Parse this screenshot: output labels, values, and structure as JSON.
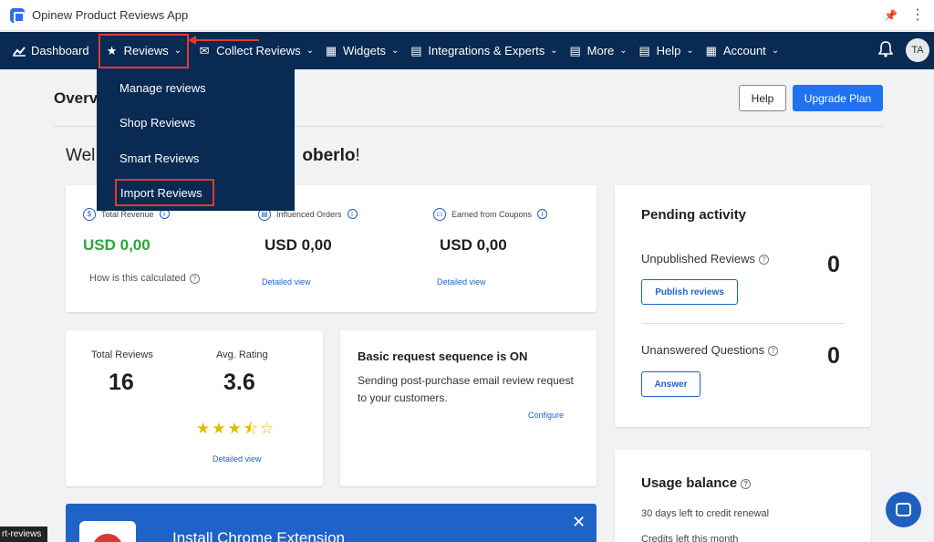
{
  "window": {
    "title": "Opinew Product Reviews App"
  },
  "nav": {
    "dashboard": "Dashboard",
    "reviews": "Reviews",
    "collect_reviews": "Collect Reviews",
    "widgets": "Widgets",
    "integrations": "Integrations & Experts",
    "more": "More",
    "help": "Help",
    "account": "Account",
    "avatar": "TA"
  },
  "dropdown": {
    "items": [
      "Manage reviews",
      "Shop Reviews",
      "Smart Reviews",
      "Import Reviews"
    ]
  },
  "header": {
    "title": "Overv",
    "help_button": "Help",
    "upgrade_button": "Upgrade Plan"
  },
  "welcome": {
    "prefix": "Wel",
    "suffix": "oberlo",
    "end": "!"
  },
  "revenue_card": {
    "total_revenue_label": "Total Revenue",
    "total_revenue_value": "USD 0,00",
    "how_calculated": "How is this calculated",
    "influenced_orders_label": "Influenced Orders",
    "influenced_orders_value": "USD 0,00",
    "influenced_link": "Detailed view",
    "coupons_label": "Earned from Coupons",
    "coupons_value": "USD 0,00",
    "coupons_link": "Detailed view"
  },
  "reviews_card": {
    "total_label": "Total Reviews",
    "total_value": "16",
    "avg_label": "Avg. Rating",
    "avg_value": "3.6",
    "stars": "★★★⯪☆",
    "link": "Detailed view"
  },
  "sequence_card": {
    "title": "Basic request sequence is ON",
    "text": "Sending post-purchase email review request to your customers.",
    "link": "Configure"
  },
  "pending_card": {
    "title": "Pending activity",
    "unpublished_label": "Unpublished Reviews",
    "unpublished_value": "0",
    "publish_button": "Publish reviews",
    "unanswered_label": "Unanswered Questions",
    "unanswered_value": "0",
    "answer_button": "Answer"
  },
  "usage_card": {
    "title": "Usage balance",
    "renewal": "30 days left to credit renewal",
    "cutoff": "Credits left this month"
  },
  "chrome_banner": {
    "text": "Install Chrome Extension"
  },
  "tooltip": {
    "text": "rt-reviews"
  },
  "colors": {
    "nav_bg": "#082a53",
    "accent": "#1f73f0",
    "highlight": "#e23b2e",
    "success": "#2aa63a"
  }
}
